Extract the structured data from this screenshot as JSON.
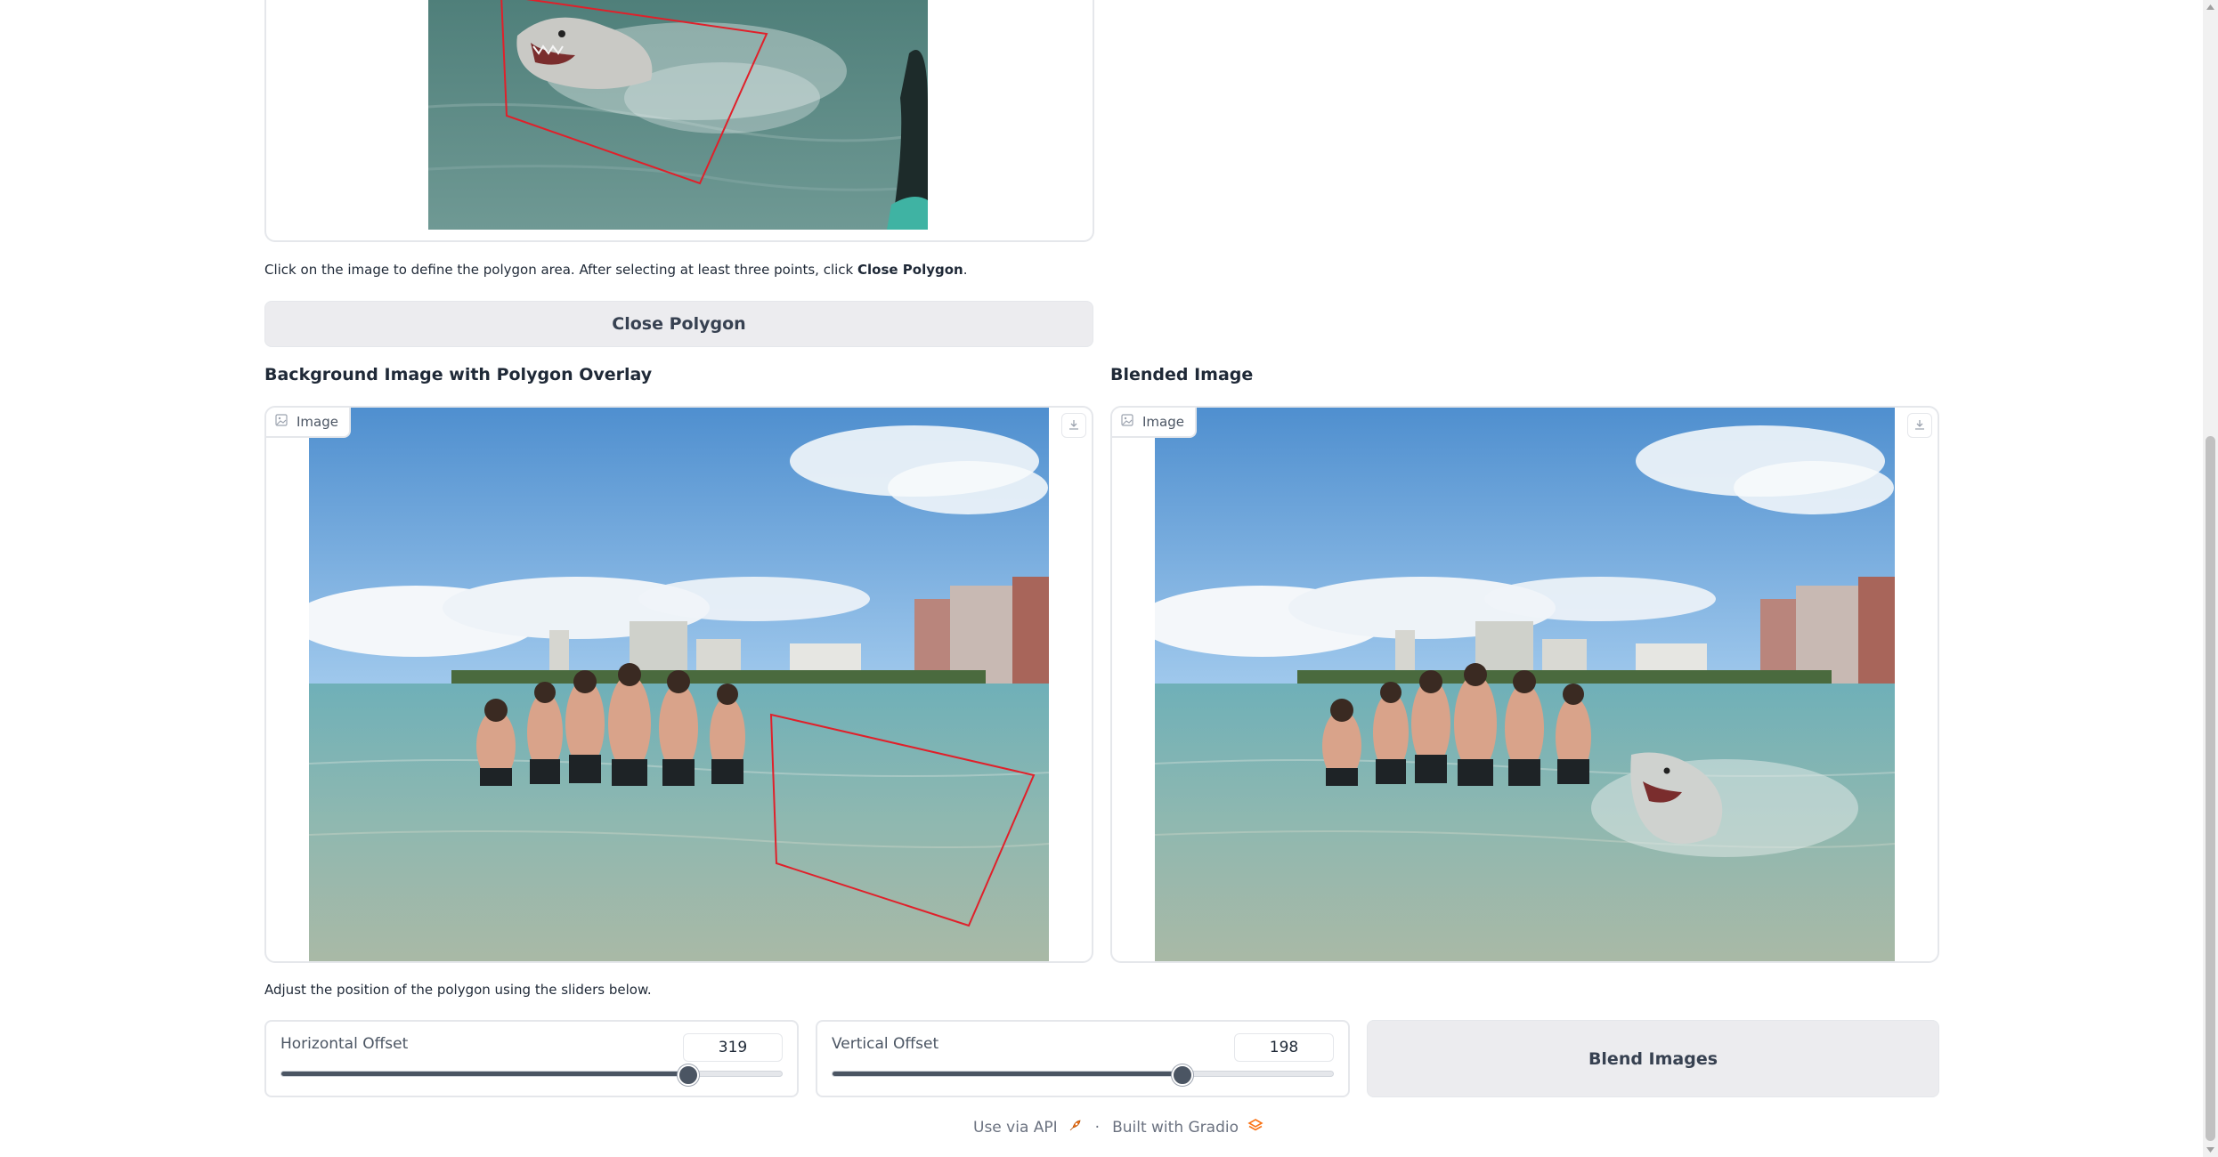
{
  "top_image": {
    "alt": "shark-with-polygon"
  },
  "instructions": {
    "prefix": "Click on the image to define the polygon area. After selecting at least three points, click ",
    "bold": "Close Polygon",
    "suffix": "."
  },
  "close_polygon_button": "Close Polygon",
  "background_panel": {
    "title": "Background Image with Polygon Overlay",
    "label": "Image"
  },
  "blended_panel": {
    "title": "Blended Image",
    "label": "Image"
  },
  "slider_instructions": "Adjust the position of the polygon using the sliders below.",
  "sliders": {
    "horizontal": {
      "label": "Horizontal Offset",
      "value": "319",
      "fraction": 0.81
    },
    "vertical": {
      "label": "Vertical Offset",
      "value": "198",
      "fraction": 0.695
    }
  },
  "blend_button": "Blend Images",
  "footer": {
    "api": "Use via API",
    "separator": "·",
    "built": "Built with Gradio"
  },
  "colors": {
    "polygon": "#e0202a",
    "slider_fill": "#4b5563",
    "gradio_orange": "#f97316"
  },
  "icons": [
    "image-icon",
    "download-icon",
    "rocket-icon",
    "gradio-logo-icon"
  ]
}
